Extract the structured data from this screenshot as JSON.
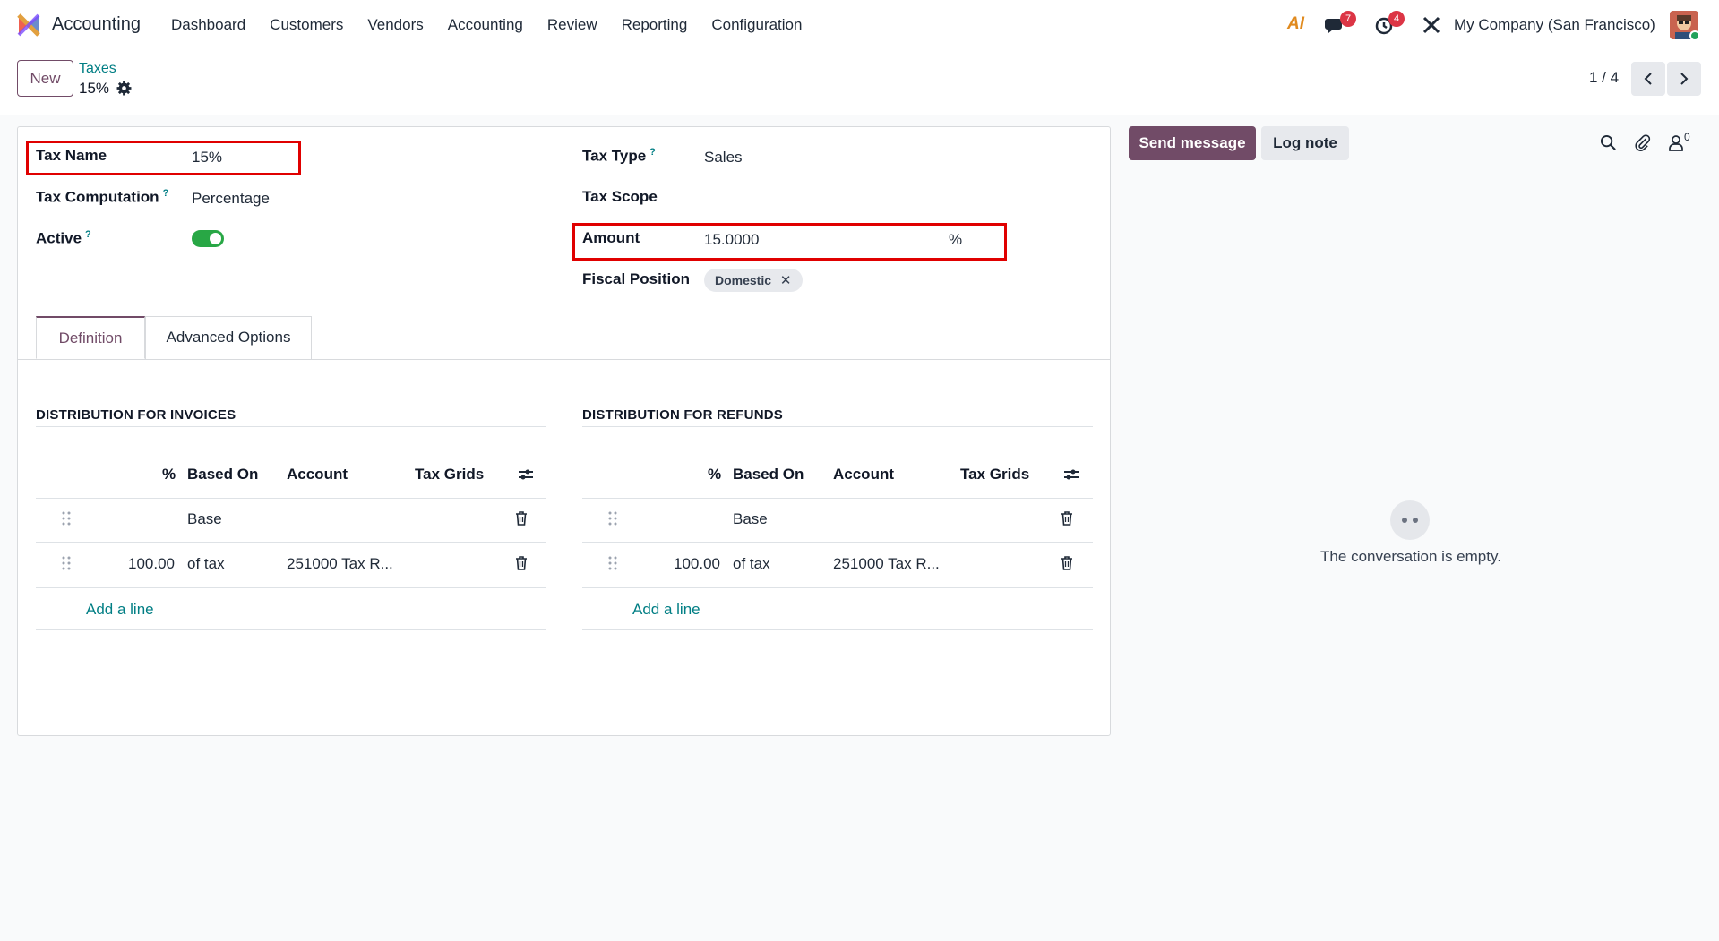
{
  "topbar": {
    "app_name": "Accounting",
    "menu": [
      "Dashboard",
      "Customers",
      "Vendors",
      "Accounting",
      "Review",
      "Reporting",
      "Configuration"
    ],
    "ai_label": "AI",
    "messages_count": "7",
    "activities_count": "4",
    "company": "My Company (San Francisco)"
  },
  "control": {
    "new_label": "New",
    "breadcrumb_parent": "Taxes",
    "breadcrumb_current": "15%",
    "pager": "1 / 4"
  },
  "form": {
    "tax_name_label": "Tax Name",
    "tax_name_value": "15%",
    "tax_computation_label": "Tax Computation",
    "tax_computation_value": "Percentage",
    "active_label": "Active",
    "active_value": true,
    "tax_type_label": "Tax Type",
    "tax_type_value": "Sales",
    "tax_scope_label": "Tax Scope",
    "amount_label": "Amount",
    "amount_value": "15.0000",
    "amount_unit": "%",
    "fiscal_position_label": "Fiscal Position",
    "fiscal_position_tag": "Domestic",
    "help_mark": "?"
  },
  "tabs": [
    {
      "label": "Definition",
      "active": true
    },
    {
      "label": "Advanced Options",
      "active": false
    }
  ],
  "invoices": {
    "title": "DISTRIBUTION FOR INVOICES",
    "headers": [
      "%",
      "Based On",
      "Account",
      "Tax Grids"
    ],
    "rows": [
      {
        "percent": "",
        "based_on": "Base",
        "account": ""
      },
      {
        "percent": "100.00",
        "based_on": "of tax",
        "account": "251000 Tax R..."
      }
    ],
    "add_line": "Add a line"
  },
  "refunds": {
    "title": "DISTRIBUTION FOR REFUNDS",
    "headers": [
      "%",
      "Based On",
      "Account",
      "Tax Grids"
    ],
    "rows": [
      {
        "percent": "",
        "based_on": "Base",
        "account": ""
      },
      {
        "percent": "100.00",
        "based_on": "of tax",
        "account": "251000 Tax R..."
      }
    ],
    "add_line": "Add a line"
  },
  "chatter": {
    "send_message": "Send message",
    "log_note": "Log note",
    "followers_count": "0",
    "empty_text": "The conversation is empty."
  },
  "colors": {
    "brand": "#714b67",
    "link": "#017e84",
    "highlight": "#e00000",
    "toggle_on": "#28a745"
  }
}
